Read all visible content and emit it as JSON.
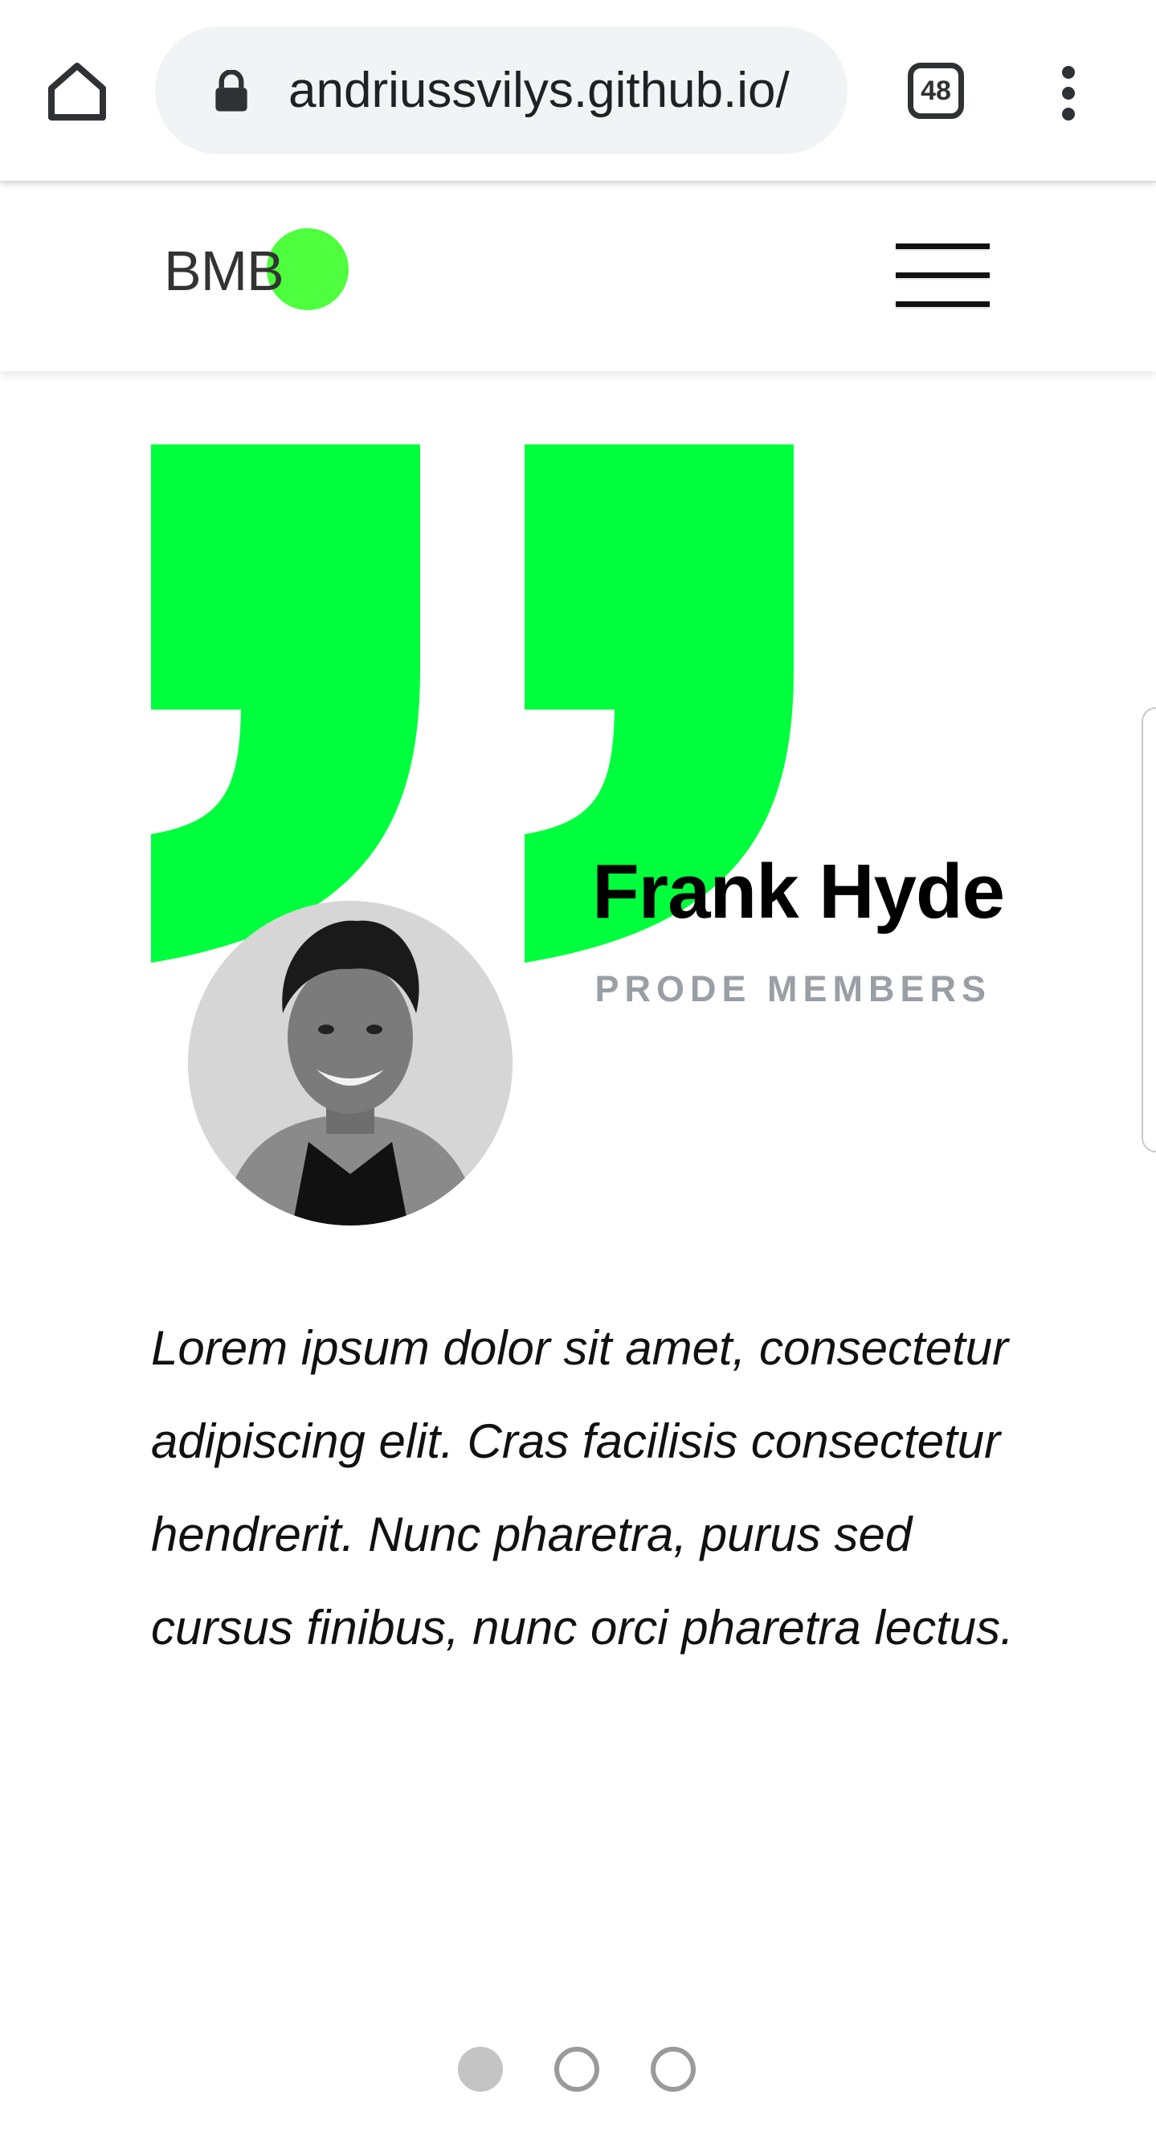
{
  "browser": {
    "url": "andriussvilys.github.io/",
    "tab_count": "48",
    "home_icon": "home-icon",
    "lock_icon": "lock-icon",
    "menu_icon": "more-vert-icon"
  },
  "header": {
    "logo_text": "BMB",
    "logo_accent": "#4dff3c",
    "menu_icon": "hamburger-menu-icon"
  },
  "testimonial": {
    "name": "Frank Hyde",
    "role": "PRODE MEMBERS",
    "quote": "Lorem ipsum dolor sit amet, consectetur adipiscing elit. Cras facilisis consectetur hendrerit. Nunc pharetra, purus sed cursus finibus, nunc orci pharetra lectus.",
    "quote_mark_color": "#00ff3c",
    "quote_icon": "closing-quote-icon"
  },
  "carousel": {
    "slides": 3,
    "active_index": 0
  }
}
